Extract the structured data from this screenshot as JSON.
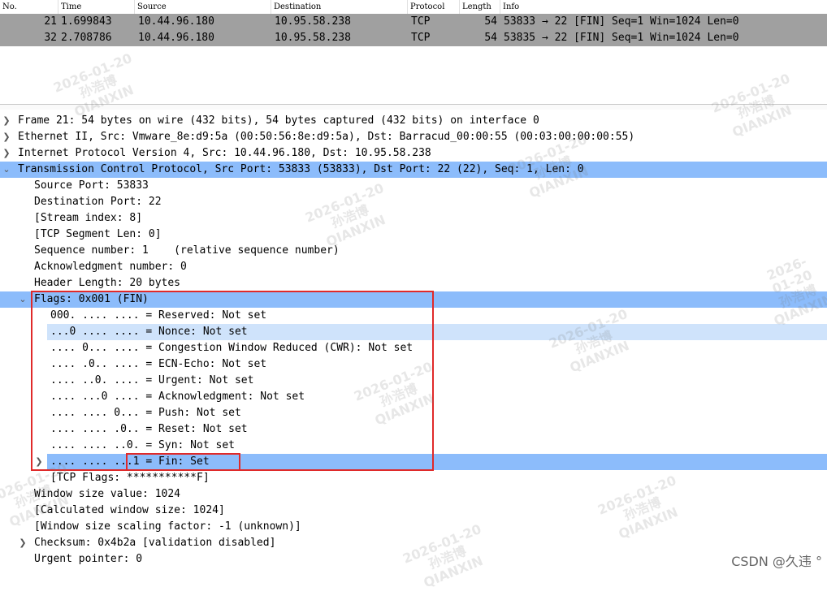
{
  "columns": [
    "No.",
    "Time",
    "Source",
    "Destination",
    "Protocol",
    "Length",
    "Info"
  ],
  "packets": [
    {
      "no": "21",
      "time": "1.699843",
      "src": "10.44.96.180",
      "dst": "10.95.58.238",
      "proto": "TCP",
      "len": "54",
      "info": "53833 → 22 [FIN] Seq=1 Win=1024 Len=0"
    },
    {
      "no": "32",
      "time": "2.708786",
      "src": "10.44.96.180",
      "dst": "10.95.58.238",
      "proto": "TCP",
      "len": "54",
      "info": "53835 → 22 [FIN] Seq=1 Win=1024 Len=0"
    }
  ],
  "tree": [
    {
      "text": "Frame 21: 54 bytes on wire (432 bits), 54 bytes captured (432 bits) on interface 0"
    },
    {
      "text": "Ethernet II, Src: Vmware_8e:d9:5a (00:50:56:8e:d9:5a), Dst: Barracud_00:00:55 (00:03:00:00:00:55)"
    },
    {
      "text": "Internet Protocol Version 4, Src: 10.44.96.180, Dst: 10.95.58.238"
    },
    {
      "text": "Transmission Control Protocol, Src Port: 53833 (53833), Dst Port: 22 (22), Seq: 1, Len: 0"
    },
    {
      "text": "Source Port: 53833"
    },
    {
      "text": "Destination Port: 22"
    },
    {
      "text": "[Stream index: 8]"
    },
    {
      "text": "[TCP Segment Len: 0]"
    },
    {
      "text": "Sequence number: 1    (relative sequence number)"
    },
    {
      "text": "Acknowledgment number: 0"
    },
    {
      "text": "Header Length: 20 bytes"
    },
    {
      "text": "Flags: 0x001 (FIN)"
    },
    {
      "text": "000. .... .... = Reserved: Not set"
    },
    {
      "text": "...0 .... .... = Nonce: Not set"
    },
    {
      "text": ".... 0... .... = Congestion Window Reduced (CWR): Not set"
    },
    {
      "text": ".... .0.. .... = ECN-Echo: Not set"
    },
    {
      "text": ".... ..0. .... = Urgent: Not set"
    },
    {
      "text": ".... ...0 .... = Acknowledgment: Not set"
    },
    {
      "text": ".... .... 0... = Push: Not set"
    },
    {
      "text": ".... .... .0.. = Reset: Not set"
    },
    {
      "text": ".... .... ..0. = Syn: Not set"
    },
    {
      "text": ".... .... ...1 = Fin: Set"
    },
    {
      "text": "[TCP Flags: ***********F]"
    },
    {
      "text": "Window size value: 1024"
    },
    {
      "text": "[Calculated window size: 1024]"
    },
    {
      "text": "[Window size scaling factor: -1 (unknown)]"
    },
    {
      "text": "Checksum: 0x4b2a [validation disabled]"
    },
    {
      "text": "Urgent pointer: 0"
    }
  ],
  "watermark": {
    "date": "2026-01-20",
    "name": "孙浩博",
    "org": "QIANXIN"
  },
  "brand": "CSDN @久违 °",
  "colors": {
    "selected": "#8cbcfb",
    "selected_light": "#cfe3fb",
    "packet_row": "#a0a0a0",
    "annotation_box": "#e02a2a"
  }
}
